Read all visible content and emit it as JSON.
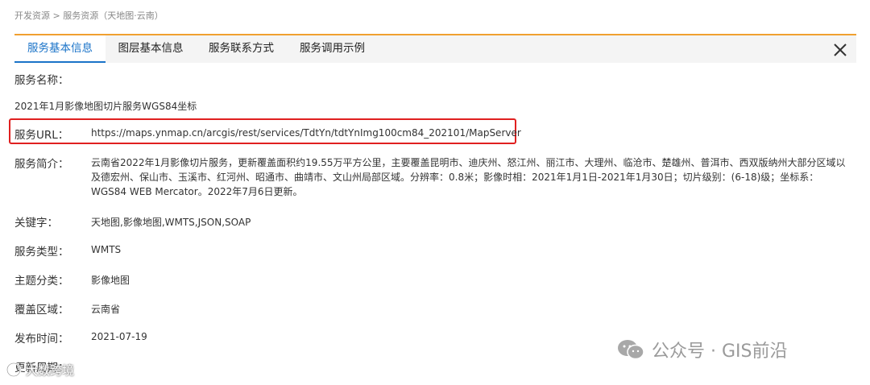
{
  "breadcrumb": {
    "item1": "开发资源",
    "sep": " > ",
    "item2": "服务资源（天地图·云南）"
  },
  "tabs": [
    {
      "label": "服务基本信息",
      "active": true
    },
    {
      "label": "图层基本信息",
      "active": false
    },
    {
      "label": "服务联系方式",
      "active": false
    },
    {
      "label": "服务调用示例",
      "active": false
    }
  ],
  "fields": {
    "name_label": "服务名称：",
    "name_value": "2021年1月影像地图切片服务WGS84坐标",
    "url_label": "服务URL：",
    "url_value": "https://maps.ynmap.cn/arcgis/rest/services/TdtYn/tdtYnImg100cm84_202101/MapServer",
    "desc_label": "服务简介：",
    "desc_value": "云南省2022年1月影像切片服务，更新覆盖面积约19.55万平方公里，主要覆盖昆明市、迪庆州、怒江州、丽江市、大理州、临沧市、楚雄州、普洱市、西双版纳州大部分区域以及德宏州、保山市、玉溪市、红河州、昭通市、曲靖市、文山州局部区域。分辨率：0.8米；影像时相：2021年1月1日-2021年1月30日；切片级别：(6-18)级；坐标系：WGS84 WEB Mercator。2022年7月6日更新。",
    "keywords_label": "关键字：",
    "keywords_value": "天地图,影像地图,WMTS,JSON,SOAP",
    "type_label": "服务类型：",
    "type_value": "WMTS",
    "topic_label": "主题分类：",
    "topic_value": "影像地图",
    "area_label": "覆盖区域：",
    "area_value": "云南省",
    "date_label": "发布时间：",
    "date_value": "2021-07-19",
    "cycle_label": "更新周期："
  },
  "watermarks": {
    "right": "公众号 · GIS前沿",
    "left": "大数跨境"
  },
  "colors": {
    "accent_orange": "#f0a030",
    "tab_active": "#1a73c8",
    "highlight_red": "#e02020"
  }
}
